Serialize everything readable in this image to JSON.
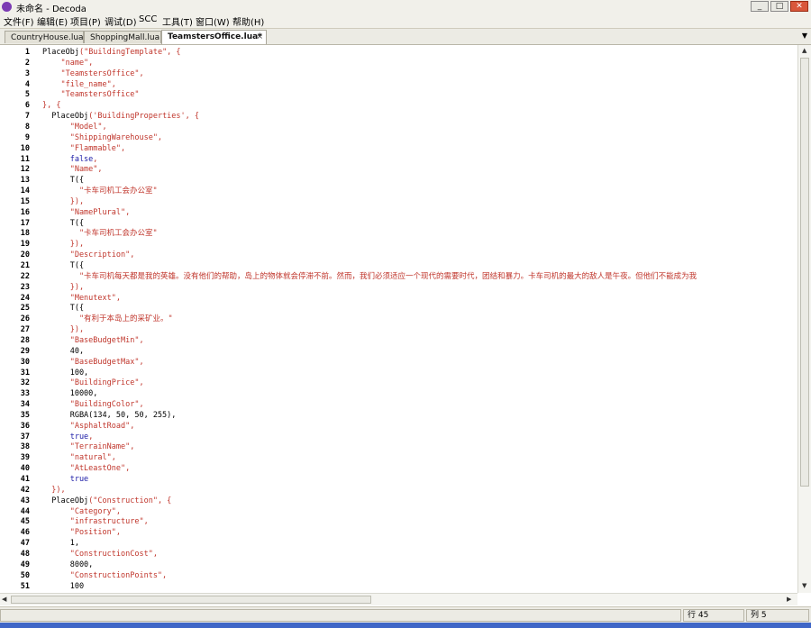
{
  "window": {
    "title": "未命名 - Decoda",
    "minimize_glyph": "_",
    "maximize_glyph": "□",
    "close_glyph": "✕"
  },
  "menu": [
    {
      "label": "文件(F)"
    },
    {
      "label": "编辑(E)"
    },
    {
      "label": "项目(P)"
    },
    {
      "label": "调试(D)"
    },
    {
      "label": "SCC"
    },
    {
      "label": "工具(T)"
    },
    {
      "label": "窗口(W)"
    },
    {
      "label": "帮助(H)"
    }
  ],
  "tabs": [
    {
      "label": "CountryHouse.lua",
      "active": false
    },
    {
      "label": "ShoppingMall.lua",
      "active": false
    },
    {
      "label": "TeamstersOffice.lua*",
      "active": true
    }
  ],
  "tab_close_glyph": "×",
  "tab_dropdown_glyph": "▼",
  "editor": {
    "lines": [
      {
        "n": "1",
        "parts": [
          [
            "c",
            "PlaceObj"
          ],
          [
            "s",
            "(\"BuildingTemplate\", {"
          ]
        ]
      },
      {
        "n": "2",
        "parts": [
          [
            "s",
            "    \"name\","
          ]
        ]
      },
      {
        "n": "3",
        "parts": [
          [
            "s",
            "    \"TeamstersOffice\","
          ]
        ]
      },
      {
        "n": "4",
        "parts": [
          [
            "s",
            "    \"file_name\","
          ]
        ]
      },
      {
        "n": "5",
        "parts": [
          [
            "s",
            "    \"TeamstersOffice\""
          ]
        ]
      },
      {
        "n": "6",
        "parts": [
          [
            "s",
            "}, {"
          ]
        ]
      },
      {
        "n": "7",
        "parts": [
          [
            "c",
            "  PlaceObj"
          ],
          [
            "s",
            "('BuildingProperties', {"
          ]
        ]
      },
      {
        "n": "8",
        "parts": [
          [
            "s",
            "      \"Model\","
          ]
        ]
      },
      {
        "n": "9",
        "parts": [
          [
            "s",
            "      \"ShippingWarehouse\","
          ]
        ]
      },
      {
        "n": "10",
        "parts": [
          [
            "s",
            "      \"Flammable\","
          ]
        ]
      },
      {
        "n": "11",
        "parts": [
          [
            "k",
            "      false"
          ],
          [
            "s",
            ","
          ]
        ]
      },
      {
        "n": "12",
        "parts": [
          [
            "s",
            "      \"Name\","
          ]
        ]
      },
      {
        "n": "13",
        "parts": [
          [
            "c",
            "      T({"
          ]
        ]
      },
      {
        "n": "14",
        "parts": [
          [
            "s",
            "        \"卡车司机工会办公室\""
          ]
        ]
      },
      {
        "n": "15",
        "parts": [
          [
            "s",
            "      }),"
          ]
        ]
      },
      {
        "n": "16",
        "parts": [
          [
            "s",
            "      \"NamePlural\","
          ]
        ]
      },
      {
        "n": "17",
        "parts": [
          [
            "c",
            "      T({"
          ]
        ]
      },
      {
        "n": "18",
        "parts": [
          [
            "s",
            "        \"卡车司机工会办公室\""
          ]
        ]
      },
      {
        "n": "19",
        "parts": [
          [
            "s",
            "      }),"
          ]
        ]
      },
      {
        "n": "20",
        "parts": [
          [
            "s",
            "      \"Description\","
          ]
        ]
      },
      {
        "n": "21",
        "parts": [
          [
            "c",
            "      T({"
          ]
        ]
      },
      {
        "n": "22",
        "parts": [
          [
            "s",
            "        \"卡车司机每天都是我的英雄。没有他们的帮助，岛上的物体就会停滞不前。然而，我们必须适应一个现代的需要时代，团结和暴力。卡车司机的最大的敌人是午夜。但他们不能成为我"
          ]
        ]
      },
      {
        "n": "23",
        "parts": [
          [
            "s",
            "      }),"
          ]
        ]
      },
      {
        "n": "24",
        "parts": [
          [
            "s",
            "      \"Menutext\","
          ]
        ]
      },
      {
        "n": "25",
        "parts": [
          [
            "c",
            "      T({"
          ]
        ]
      },
      {
        "n": "26",
        "parts": [
          [
            "s",
            "        \"有利于本岛上的采矿业。\""
          ]
        ]
      },
      {
        "n": "27",
        "parts": [
          [
            "s",
            "      }),"
          ]
        ]
      },
      {
        "n": "28",
        "parts": [
          [
            "s",
            "      \"BaseBudgetMin\","
          ]
        ]
      },
      {
        "n": "29",
        "parts": [
          [
            "c",
            "      40,"
          ]
        ]
      },
      {
        "n": "30",
        "parts": [
          [
            "s",
            "      \"BaseBudgetMax\","
          ]
        ]
      },
      {
        "n": "31",
        "parts": [
          [
            "c",
            "      100,"
          ]
        ]
      },
      {
        "n": "32",
        "parts": [
          [
            "s",
            "      \"BuildingPrice\","
          ]
        ]
      },
      {
        "n": "33",
        "parts": [
          [
            "c",
            "      10000,"
          ]
        ]
      },
      {
        "n": "34",
        "parts": [
          [
            "s",
            "      \"BuildingColor\","
          ]
        ]
      },
      {
        "n": "35",
        "parts": [
          [
            "c",
            "      RGBA(134, 50, 50, 255),"
          ]
        ]
      },
      {
        "n": "36",
        "parts": [
          [
            "s",
            "      \"AsphaltRoad\","
          ]
        ]
      },
      {
        "n": "37",
        "parts": [
          [
            "k",
            "      true"
          ],
          [
            "s",
            ","
          ]
        ]
      },
      {
        "n": "38",
        "parts": [
          [
            "s",
            "      \"TerrainName\","
          ]
        ]
      },
      {
        "n": "39",
        "parts": [
          [
            "s",
            "      \"natural\","
          ]
        ]
      },
      {
        "n": "40",
        "parts": [
          [
            "s",
            "      \"AtLeastOne\","
          ]
        ]
      },
      {
        "n": "41",
        "parts": [
          [
            "k",
            "      true"
          ]
        ]
      },
      {
        "n": "42",
        "parts": [
          [
            "s",
            "  }),"
          ]
        ]
      },
      {
        "n": "43",
        "parts": [
          [
            "c",
            "  PlaceObj"
          ],
          [
            "s",
            "(\"Construction\", {"
          ]
        ]
      },
      {
        "n": "44",
        "parts": [
          [
            "s",
            "      \"Category\","
          ]
        ]
      },
      {
        "n": "45",
        "parts": [
          [
            "s",
            "      \"infrastructure\","
          ]
        ]
      },
      {
        "n": "46",
        "parts": [
          [
            "s",
            "      \"Position\","
          ]
        ]
      },
      {
        "n": "47",
        "parts": [
          [
            "c",
            "      1,"
          ]
        ]
      },
      {
        "n": "48",
        "parts": [
          [
            "s",
            "      \"ConstructionCost\","
          ]
        ]
      },
      {
        "n": "49",
        "parts": [
          [
            "c",
            "      8000,"
          ]
        ]
      },
      {
        "n": "50",
        "parts": [
          [
            "s",
            "      \"ConstructionPoints\","
          ]
        ]
      },
      {
        "n": "51",
        "parts": [
          [
            "c",
            "      100"
          ]
        ]
      }
    ]
  },
  "status": {
    "line": "行 45",
    "col": "列 5"
  }
}
